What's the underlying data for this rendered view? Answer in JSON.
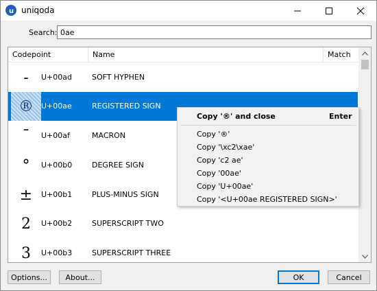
{
  "window": {
    "title": "uniqoda"
  },
  "search": {
    "label": "Search:",
    "value": "0ae"
  },
  "table": {
    "headers": {
      "codepoint": "Codepoint",
      "name": "Name",
      "match": "Match"
    },
    "rows": [
      {
        "glyph": "‐",
        "codepoint": "U+00ad",
        "name": "SOFT HYPHEN"
      },
      {
        "glyph": "®",
        "codepoint": "U+00ae",
        "name": "REGISTERED SIGN"
      },
      {
        "glyph": "¯",
        "codepoint": "U+00af",
        "name": "MACRON"
      },
      {
        "glyph": "°",
        "codepoint": "U+00b0",
        "name": "DEGREE SIGN"
      },
      {
        "glyph": "±",
        "codepoint": "U+00b1",
        "name": "PLUS-MINUS SIGN"
      },
      {
        "glyph": "2",
        "codepoint": "U+00b2",
        "name": "SUPERSCRIPT TWO"
      },
      {
        "glyph": "3",
        "codepoint": "U+00b3",
        "name": "SUPERSCRIPT THREE"
      }
    ]
  },
  "context_menu": {
    "default_item": {
      "label": "Copy '®' and close",
      "shortcut": "Enter"
    },
    "items": [
      "Copy '®'",
      "Copy '\\xc2\\xae'",
      "Copy 'c2 ae'",
      "Copy '00ae'",
      "Copy 'U+00ae'",
      "Copy '<U+00ae REGISTERED SIGN>'"
    ]
  },
  "buttons": {
    "options": "Options...",
    "about": "About...",
    "ok": "OK",
    "cancel": "Cancel"
  },
  "colors": {
    "selection": "#0078d7",
    "app_icon": "#1a5fbf"
  }
}
